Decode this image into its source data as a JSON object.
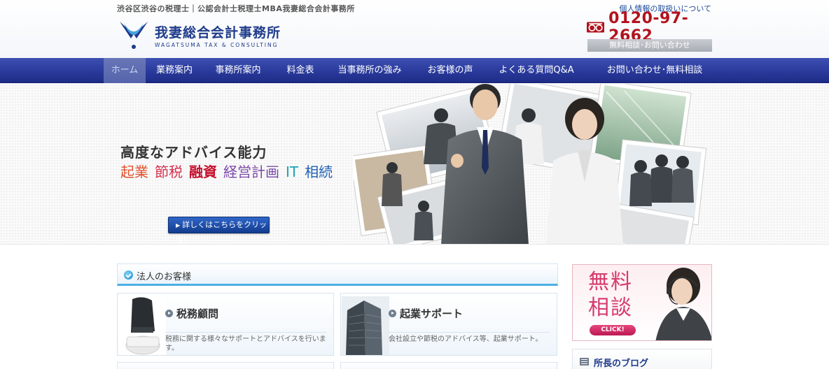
{
  "header": {
    "tagline": "渋谷区渋谷の税理士｜公認会計士税理士MBA我妻総合会計事務所",
    "privacy_link": "個人情報の取扱いについて",
    "logo_name": "我妻総合会計事務所",
    "logo_sub": "WAGATSUMA TAX & CONSULTING",
    "phone": "0120-97-2662",
    "consult_label": "無料相談･お問い合わせ"
  },
  "nav": {
    "items": [
      {
        "label": "ホーム",
        "active": true
      },
      {
        "label": "業務案内"
      },
      {
        "label": "事務所案内"
      },
      {
        "label": "料金表"
      },
      {
        "label": "当事務所の強み"
      },
      {
        "label": "お客様の声"
      },
      {
        "label": "よくある質問Q&A"
      },
      {
        "label": "お問い合わせ･無料相談"
      }
    ]
  },
  "hero": {
    "title": "高度なアドバイス能力",
    "keywords": [
      {
        "text": "起業",
        "color": "#e0522d"
      },
      {
        "text": "節税",
        "color": "#d8314f"
      },
      {
        "text": "融資",
        "color": "#c6102d"
      },
      {
        "text": "経営計画",
        "color": "#7a48a8"
      },
      {
        "text": "IT",
        "color": "#1ba6b7"
      },
      {
        "text": "相続",
        "color": "#1e5fb3"
      }
    ],
    "button_label": "詳しくはこちらをクリック!"
  },
  "section": {
    "title": "法人のお客様"
  },
  "services": [
    {
      "title": "税務顧問",
      "desc": "税務に関する様々なサポートとアドバイスを行います。"
    },
    {
      "title": "起業サポート",
      "desc": "会社設立や節税のアドバイス等、起業サポート。"
    }
  ],
  "sidebar": {
    "banner_line1": "無料",
    "banner_line2": "相談",
    "click_label": "CLICK!",
    "blog_title": "所長のブログ"
  },
  "colors": {
    "nav": "#2a3a9b",
    "brand": "#1e3a8a",
    "phone": "#b3121d",
    "accent_line": "#4bb0e4",
    "banner_pink": "#d63a6e"
  }
}
